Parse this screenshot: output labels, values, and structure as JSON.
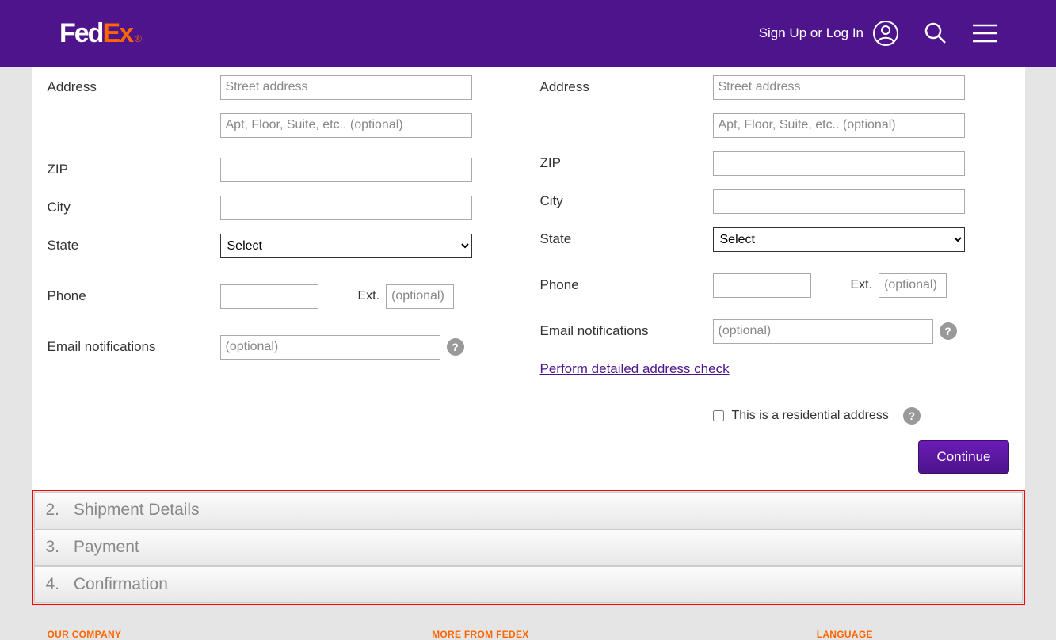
{
  "header": {
    "logo_fed": "Fed",
    "logo_ex": "Ex",
    "logo_dot": "®",
    "signin_label": "Sign Up or Log In"
  },
  "form": {
    "left": {
      "address_label": "Address",
      "street_placeholder": "Street address",
      "apt_placeholder": "Apt, Floor, Suite, etc.. (optional)",
      "zip_label": "ZIP",
      "city_label": "City",
      "state_label": "State",
      "state_select": "Select",
      "phone_label": "Phone",
      "ext_label": "Ext.",
      "ext_placeholder": "(optional)",
      "email_label": "Email notifications",
      "email_placeholder": "(optional)"
    },
    "right": {
      "address_label": "Address",
      "street_placeholder": "Street address",
      "apt_placeholder": "Apt, Floor, Suite, etc.. (optional)",
      "zip_label": "ZIP",
      "city_label": "City",
      "state_label": "State",
      "state_select": "Select",
      "phone_label": "Phone",
      "ext_label": "Ext.",
      "ext_placeholder": "(optional)",
      "email_label": "Email notifications",
      "email_placeholder": "(optional)",
      "address_check_link": "Perform detailed address check",
      "residential_label": "This is a residential address"
    },
    "continue_label": "Continue"
  },
  "steps": {
    "s2_num": "2.",
    "s2_label": "Shipment Details",
    "s3_num": "3.",
    "s3_label": "Payment",
    "s4_num": "4.",
    "s4_label": "Confirmation"
  },
  "footer": {
    "our_company": "OUR COMPANY",
    "more_from": "MORE FROM FEDEX",
    "language": "LANGUAGE"
  }
}
